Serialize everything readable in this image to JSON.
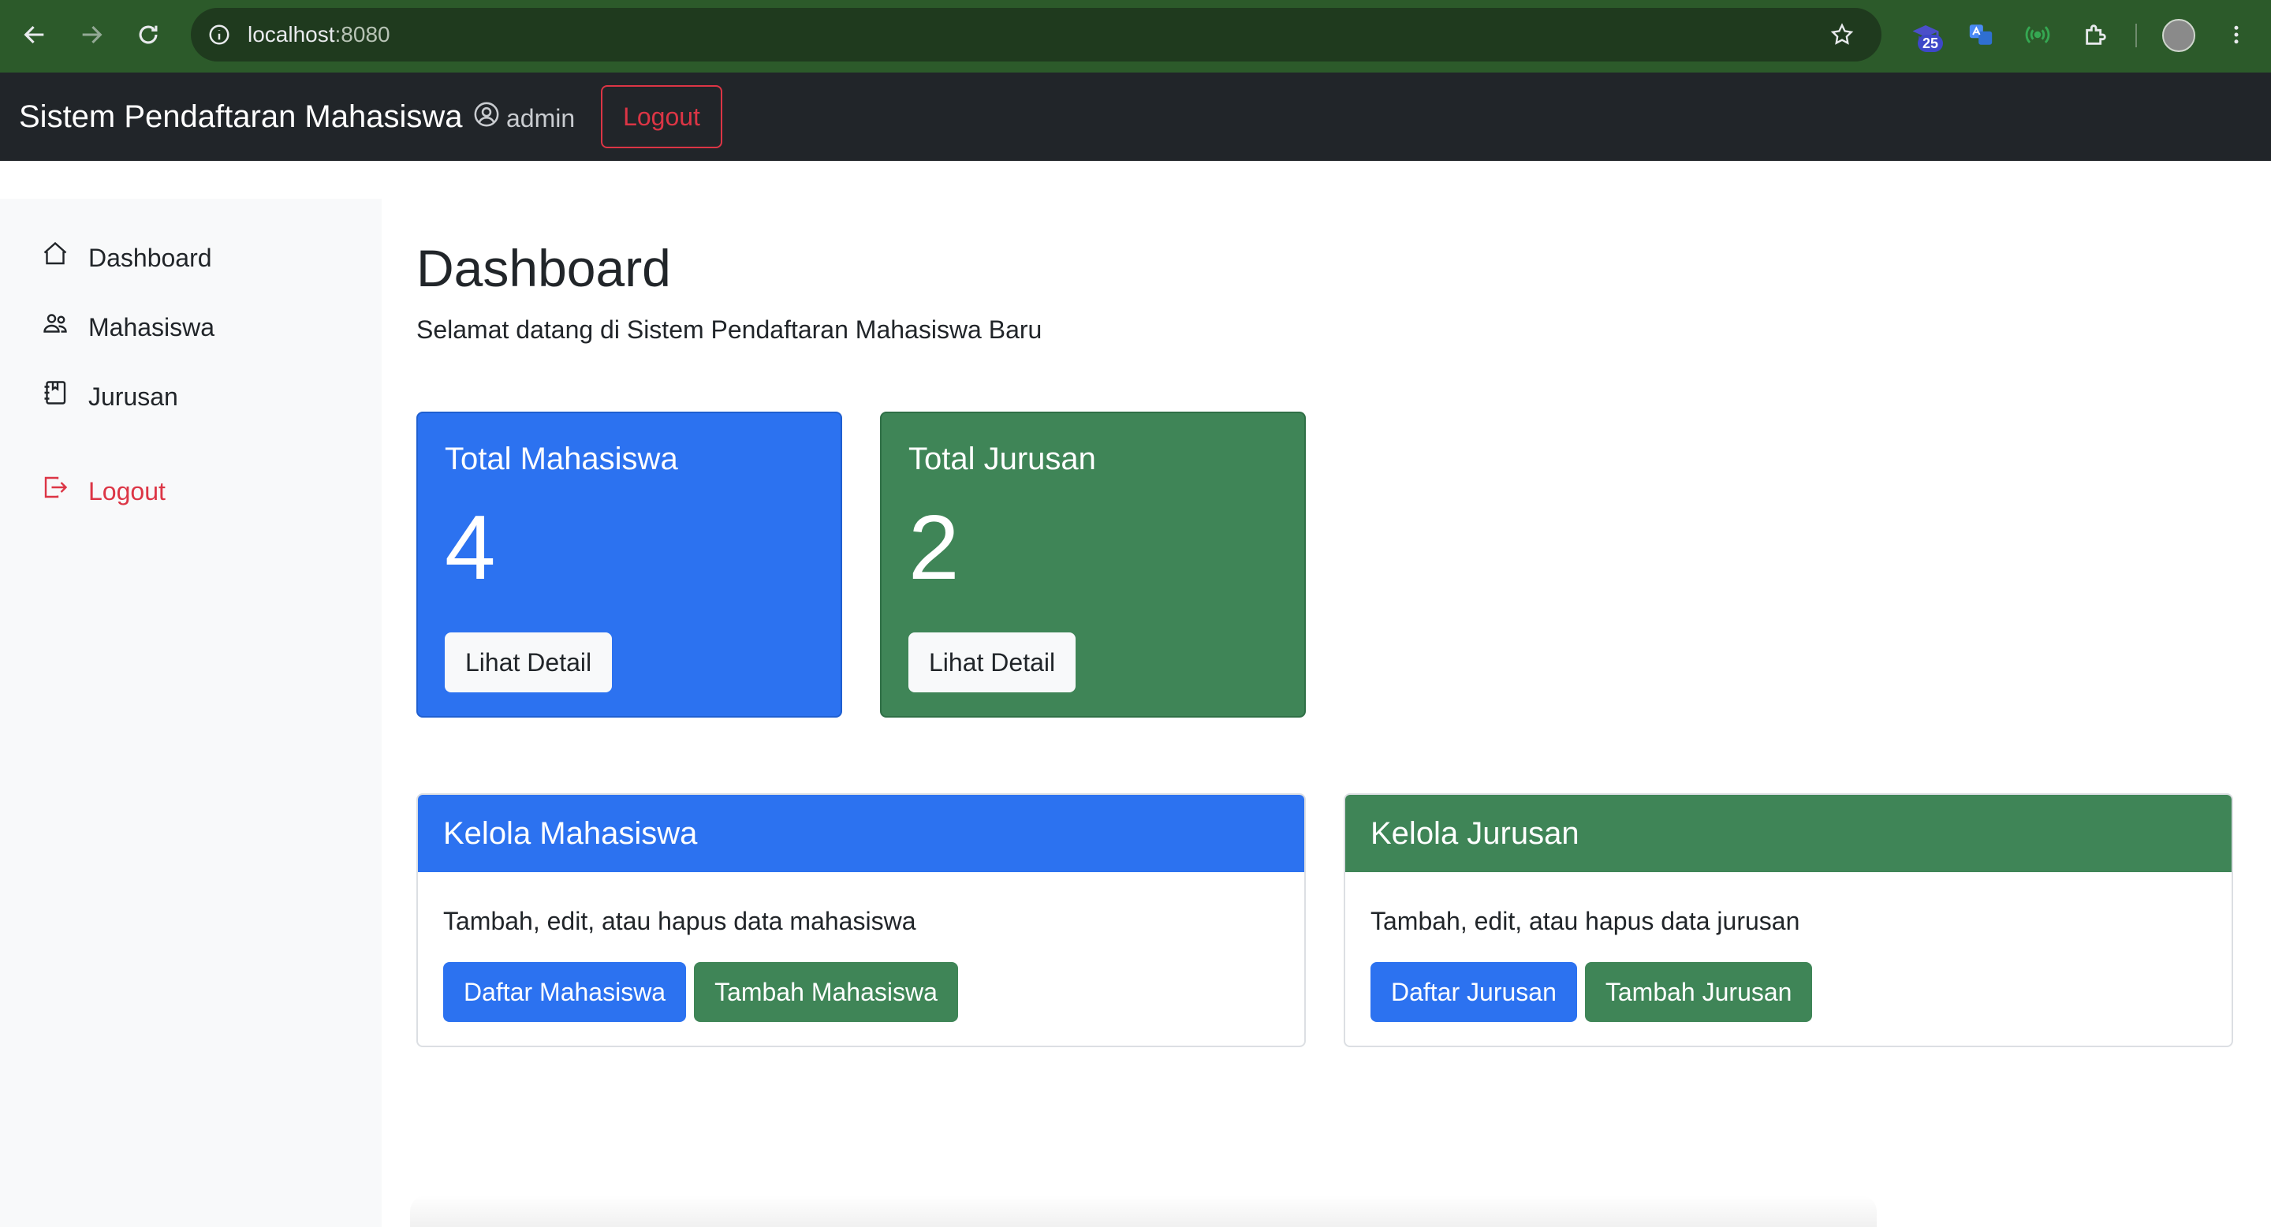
{
  "browser": {
    "url_host": "localhost",
    "url_port": ":8080",
    "extension_badge": "25"
  },
  "navbar": {
    "brand": "Sistem Pendaftaran Mahasiswa",
    "user": "admin",
    "logout": "Logout"
  },
  "sidebar": {
    "items": [
      {
        "label": "Dashboard",
        "icon": "house-icon"
      },
      {
        "label": "Mahasiswa",
        "icon": "people-icon"
      },
      {
        "label": "Jurusan",
        "icon": "journal-icon"
      },
      {
        "label": "Logout",
        "icon": "box-arrow-right-icon"
      }
    ]
  },
  "main": {
    "title": "Dashboard",
    "subtitle": "Selamat datang di Sistem Pendaftaran Mahasiswa Baru",
    "stats": [
      {
        "title": "Total Mahasiswa",
        "value": "4",
        "button": "Lihat Detail"
      },
      {
        "title": "Total Jurusan",
        "value": "2",
        "button": "Lihat Detail"
      }
    ],
    "panels": [
      {
        "title": "Kelola Mahasiswa",
        "text": "Tambah, edit, atau hapus data mahasiswa",
        "primary": "Daftar Mahasiswa",
        "secondary": "Tambah Mahasiswa"
      },
      {
        "title": "Kelola Jurusan",
        "text": "Tambah, edit, atau hapus data jurusan",
        "primary": "Daftar Jurusan",
        "secondary": "Tambah Jurusan"
      }
    ]
  },
  "colors": {
    "primary": "#2c72f0",
    "success": "#3f8557",
    "danger": "#dc3545",
    "navbar": "#212529"
  }
}
